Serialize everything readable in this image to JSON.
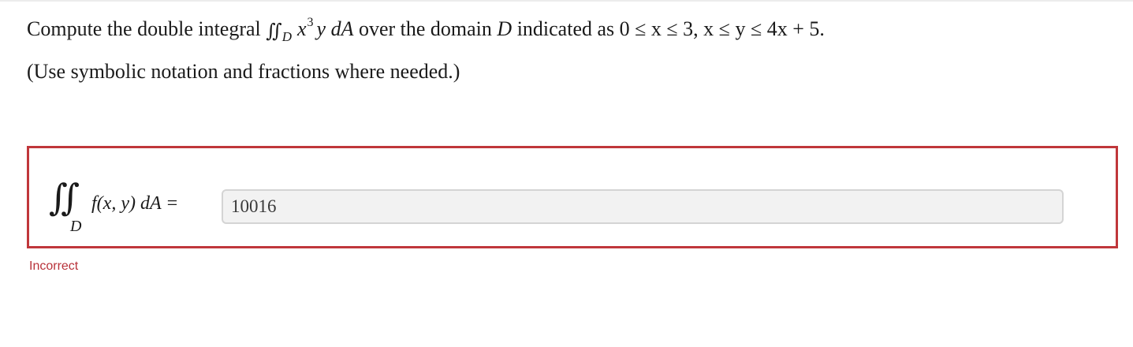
{
  "question": {
    "prefix": "Compute the double integral ",
    "integral_symbol": "∬",
    "region_subscript": "D",
    "integrand_base": "x",
    "integrand_exponent": "3",
    "integrand_rest": "y dA",
    "middle_text": " over the domain ",
    "domain_name": "D",
    "bounds_text": " indicated as 0 ≤ x ≤ 3, x ≤ y ≤ 4x + 5."
  },
  "instructions": "(Use symbolic notation and fractions where needed.)",
  "answer": {
    "integral_symbol": "∬",
    "region_subscript": "D",
    "lhs_expression": "f(x, y) dA  =",
    "input_value": "10016"
  },
  "status": {
    "text": "Incorrect",
    "color": "#b8323a"
  }
}
